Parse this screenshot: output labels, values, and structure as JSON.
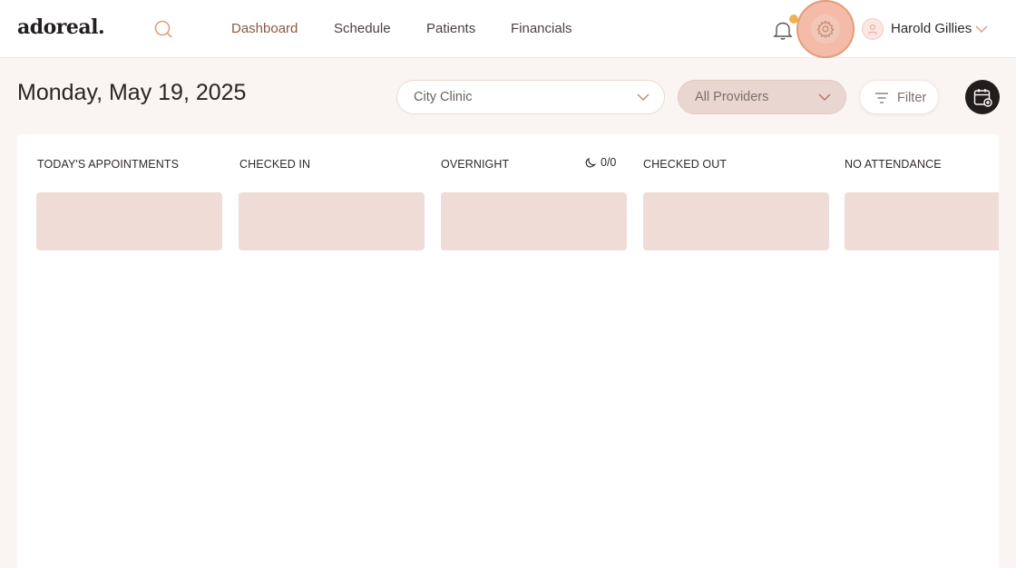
{
  "header": {
    "logo": "adoreal.",
    "nav": [
      {
        "label": "Dashboard",
        "active": true
      },
      {
        "label": "Schedule",
        "active": false
      },
      {
        "label": "Patients",
        "active": false
      },
      {
        "label": "Financials",
        "active": false
      }
    ],
    "icons": {
      "search": "search-icon",
      "bell": "bell-icon",
      "settings": "gear-icon",
      "avatar": "user-icon"
    },
    "user_name": "Harold Gillies",
    "notification_dot_color": "#f2b24a"
  },
  "toolbar": {
    "date": "Monday, May 19, 2025",
    "location_select": "City Clinic",
    "provider_select": "All Providers",
    "filter_label": "Filter",
    "calendar_button_icon": "calendar-add-icon"
  },
  "board": {
    "columns": [
      {
        "title": "TODAY'S APPOINTMENTS"
      },
      {
        "title": "CHECKED IN"
      },
      {
        "title": "OVERNIGHT",
        "badge": "0/0"
      },
      {
        "title": "CHECKED OUT"
      },
      {
        "title": "NO ATTENDANCE"
      }
    ]
  },
  "colors": {
    "accent": "#8b5a45",
    "background": "#faf5f2",
    "skeleton": "#efdcd7",
    "settings_highlight": "#f4bca8"
  }
}
